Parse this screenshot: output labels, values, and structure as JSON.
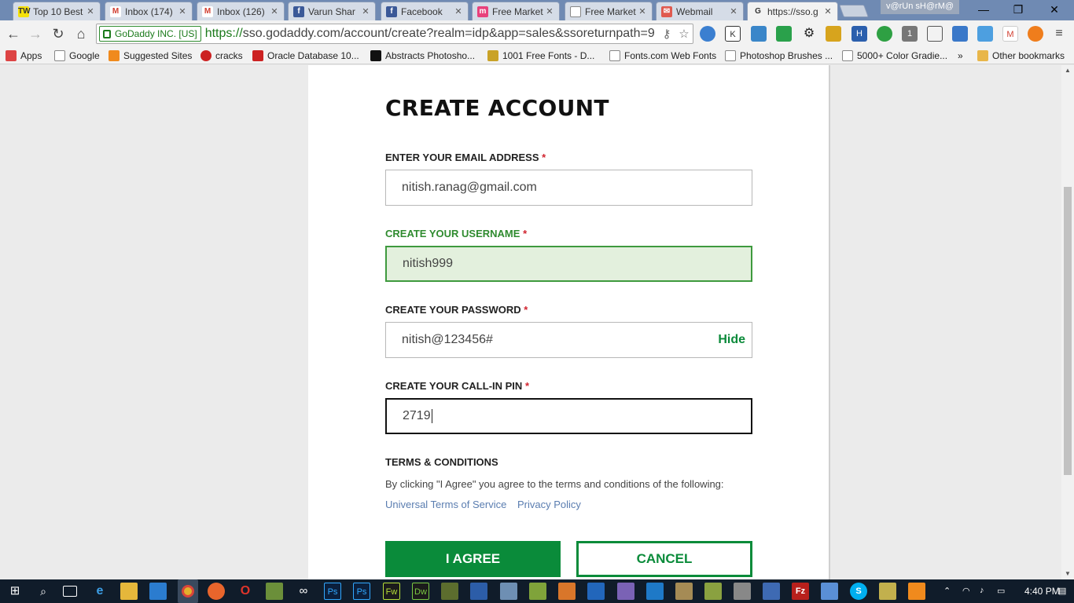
{
  "browser": {
    "tabs": [
      {
        "title": "Top 10 Best",
        "favicon": "tw-icon",
        "fav_text": "TW",
        "fav_color": "#f5e10a",
        "fav_fg": "#333"
      },
      {
        "title": "Inbox (174)",
        "favicon": "gmail-icon",
        "fav_text": "M",
        "fav_color": "#ffffff",
        "fav_fg": "#d23f31"
      },
      {
        "title": "Inbox (126)",
        "favicon": "gmail-icon",
        "fav_text": "M",
        "fav_color": "#ffffff",
        "fav_fg": "#d23f31"
      },
      {
        "title": "Varun Shar",
        "favicon": "facebook-icon",
        "fav_text": "f",
        "fav_color": "#3b5998",
        "fav_fg": "#fff"
      },
      {
        "title": "Facebook",
        "favicon": "facebook-icon",
        "fav_text": "f",
        "fav_color": "#3b5998",
        "fav_fg": "#fff"
      },
      {
        "title": "Free Market",
        "favicon": "market-icon",
        "fav_text": "m",
        "fav_color": "#e8417c",
        "fav_fg": "#fff"
      },
      {
        "title": "Free Market",
        "favicon": "page-icon",
        "fav_text": "",
        "fav_color": "#ffffff",
        "fav_fg": "#333"
      },
      {
        "title": "Webmail",
        "favicon": "mail-icon",
        "fav_text": "✉",
        "fav_color": "#e05a4f",
        "fav_fg": "#fff"
      },
      {
        "title": "https://sso.g",
        "favicon": "godaddy-icon",
        "fav_text": "G",
        "fav_color": "#f2f2f2",
        "fav_fg": "#333"
      }
    ],
    "profile_name": "v@rUn sH@rM@",
    "window_controls": {
      "minimize": "—",
      "restore": "❐",
      "close": "✕"
    },
    "ev_org": "GoDaddy INC. [US]",
    "url_scheme": "https://",
    "url_rest": "sso.godaddy.com/account/create?realm=idp&app=sales&ssoreturnpath=9",
    "bookmarks": [
      {
        "label": "Apps",
        "icon": "apps-icon"
      },
      {
        "label": "Google",
        "icon": "page-icon"
      },
      {
        "label": "Suggested Sites",
        "icon": "suggested-sites-icon"
      },
      {
        "label": "cracks",
        "icon": "cracks-icon"
      },
      {
        "label": "Oracle Database 10...",
        "icon": "oracle-icon"
      },
      {
        "label": "Abstracts Photosho...",
        "icon": "bd-icon"
      },
      {
        "label": "1001 Free Fonts - D...",
        "icon": "fonts-icon"
      },
      {
        "label": "Fonts.com Web Fonts",
        "icon": "page-icon"
      },
      {
        "label": "Photoshop Brushes ...",
        "icon": "page-icon"
      },
      {
        "label": "5000+ Color Gradie...",
        "icon": "page-icon"
      }
    ],
    "bookmarks_overflow": "»",
    "other_bookmarks": "Other bookmarks"
  },
  "form": {
    "heading": "CREATE ACCOUNT",
    "required_mark": "*",
    "email_label": "ENTER YOUR EMAIL ADDRESS",
    "email_value": "nitish.ranag@gmail.com",
    "username_label": "CREATE YOUR USERNAME",
    "username_value": "nitish999",
    "password_label": "CREATE YOUR PASSWORD",
    "password_value": "nitish@123456#",
    "password_toggle": "Hide",
    "pin_label": "CREATE YOUR CALL-IN PIN",
    "pin_value": "2719",
    "terms_title": "TERMS & CONDITIONS",
    "terms_text": "By clicking \"I Agree\" you agree to the terms and conditions of the following:",
    "terms_link_1": "Universal Terms of Service",
    "terms_link_2": "Privacy Policy",
    "agree_button": "I AGREE",
    "cancel_button": "CANCEL"
  },
  "colors": {
    "brand_green": "#0a8b3a",
    "valid_bg": "#e3f0dd",
    "link_blue": "#5a7db0",
    "required_red": "#d1242f"
  },
  "taskbar": {
    "clock": "4:40 PM"
  }
}
